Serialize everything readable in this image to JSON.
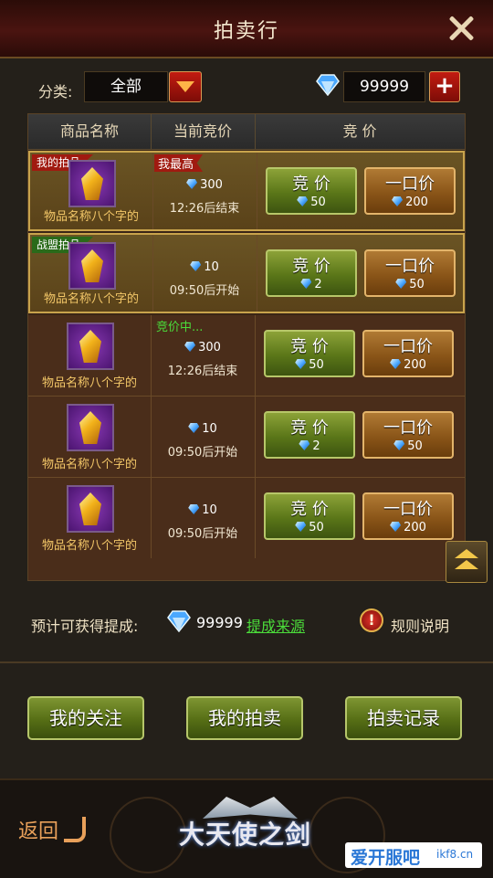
{
  "header": {
    "title": "拍卖行"
  },
  "filter": {
    "label": "分类:",
    "selected": "全部",
    "currency": "99999"
  },
  "table": {
    "columns": [
      "商品名称",
      "当前竞价",
      "竞 价"
    ],
    "rows": [
      {
        "tag": "我的拍品",
        "status": "我最高",
        "name": "物品名称八个字的",
        "price": "300",
        "time": "12:26后结束",
        "bid_label": "竞 价",
        "bid_cost": "50",
        "buy_label": "一口价",
        "buy_cost": "200"
      },
      {
        "tag": "战盟拍品",
        "status": "",
        "name": "物品名称八个字的",
        "price": "10",
        "time": "09:50后开始",
        "bid_label": "竞 价",
        "bid_cost": "2",
        "buy_label": "一口价",
        "buy_cost": "50"
      },
      {
        "tag": "",
        "status": "竞价中...",
        "name": "物品名称八个字的",
        "price": "300",
        "time": "12:26后结束",
        "bid_label": "竞 价",
        "bid_cost": "50",
        "buy_label": "一口价",
        "buy_cost": "200"
      },
      {
        "tag": "",
        "status": "",
        "name": "物品名称八个字的",
        "price": "10",
        "time": "09:50后开始",
        "bid_label": "竞 价",
        "bid_cost": "2",
        "buy_label": "一口价",
        "buy_cost": "50"
      },
      {
        "tag": "",
        "status": "",
        "name": "物品名称八个字的",
        "price": "10",
        "time": "09:50后开始",
        "bid_label": "竞 价",
        "bid_cost": "50",
        "buy_label": "一口价",
        "buy_cost": "200"
      }
    ]
  },
  "estimate": {
    "label": "预计可获得提成:",
    "value": "99999",
    "link": "提成来源",
    "rules": "规则说明"
  },
  "actions": {
    "follow": "我的关注",
    "my_auction": "我的拍卖",
    "records": "拍卖记录"
  },
  "footer": {
    "back": "返回",
    "logo": "大天使之剑",
    "watermark": "爱开服吧",
    "watermark_url": "ikf8.cn"
  }
}
